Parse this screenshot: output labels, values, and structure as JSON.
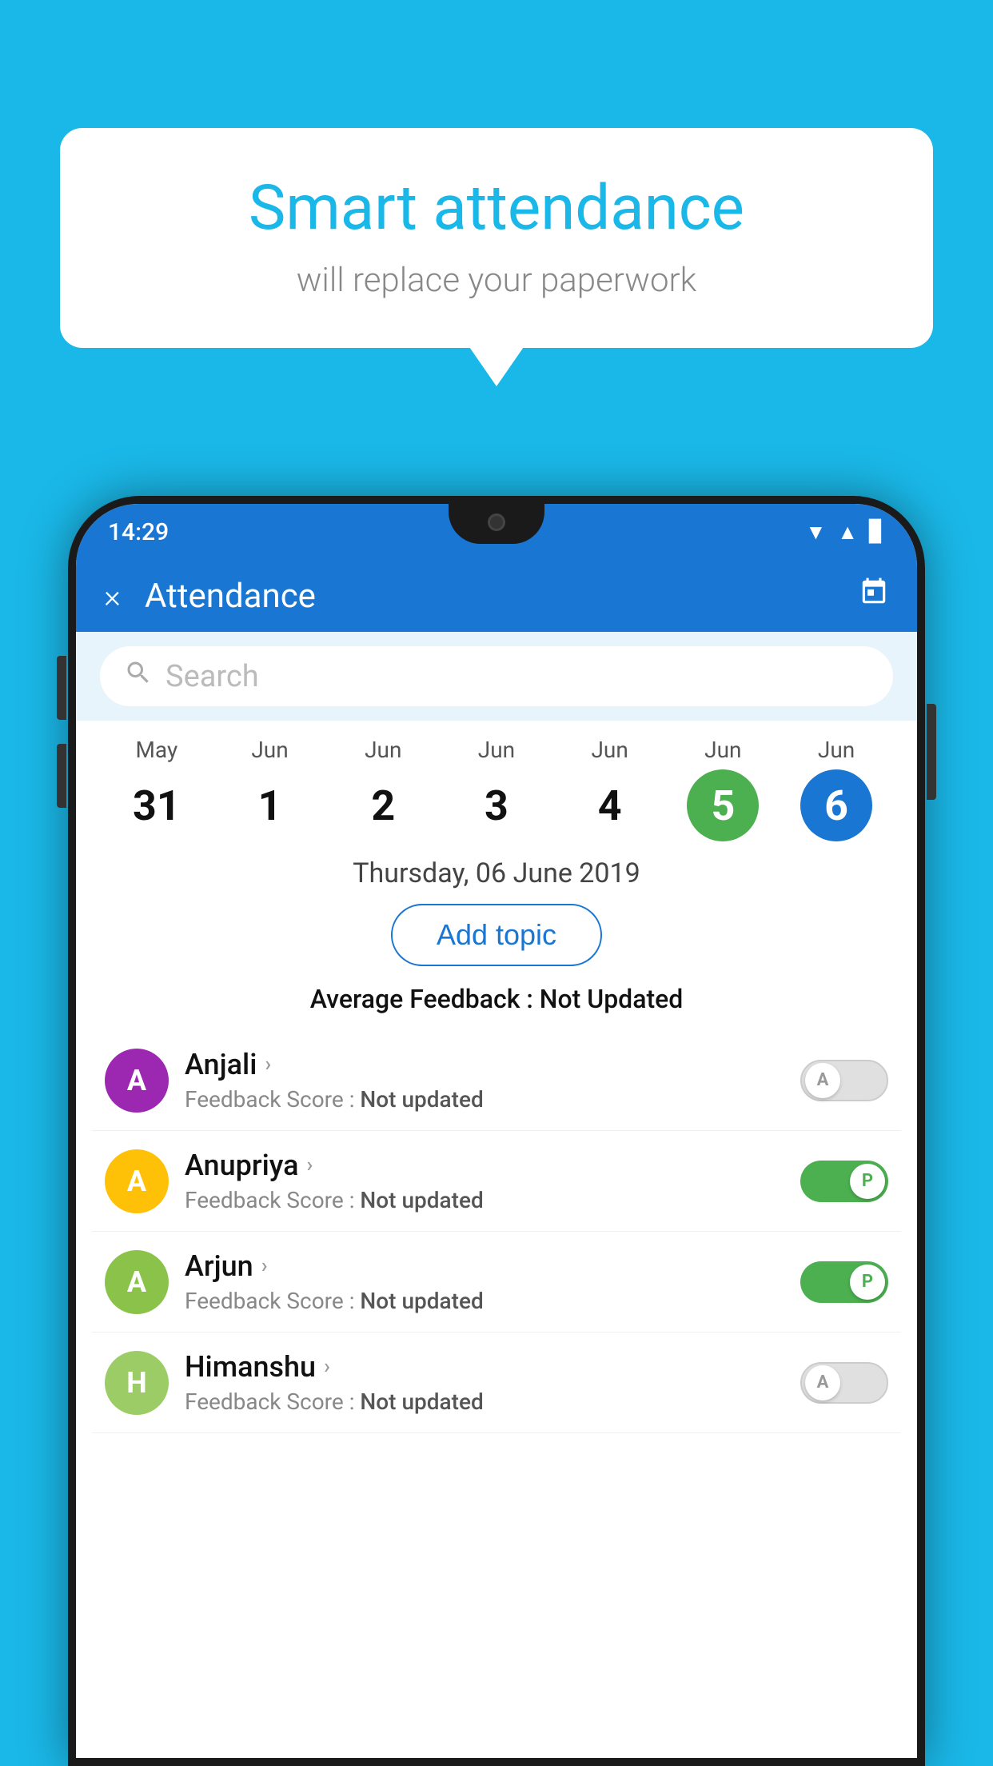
{
  "background_color": "#1ab8e8",
  "bubble": {
    "title": "Smart attendance",
    "subtitle": "will replace your paperwork"
  },
  "status_bar": {
    "time": "14:29",
    "icons": [
      "wifi",
      "signal",
      "battery"
    ]
  },
  "header": {
    "title": "Attendance",
    "close_label": "×",
    "calendar_icon": "📅"
  },
  "search": {
    "placeholder": "Search"
  },
  "calendar": {
    "days": [
      {
        "month": "May",
        "date": "31",
        "state": "normal"
      },
      {
        "month": "Jun",
        "date": "1",
        "state": "normal"
      },
      {
        "month": "Jun",
        "date": "2",
        "state": "normal"
      },
      {
        "month": "Jun",
        "date": "3",
        "state": "normal"
      },
      {
        "month": "Jun",
        "date": "4",
        "state": "normal"
      },
      {
        "month": "Jun",
        "date": "5",
        "state": "today"
      },
      {
        "month": "Jun",
        "date": "6",
        "state": "selected"
      }
    ]
  },
  "selected_date": "Thursday, 06 June 2019",
  "add_topic_label": "Add topic",
  "average_feedback": {
    "label": "Average Feedback : ",
    "value": "Not Updated"
  },
  "students": [
    {
      "name": "Anjali",
      "avatar_letter": "A",
      "avatar_color": "#9c27b0",
      "feedback_label": "Feedback Score : ",
      "feedback_value": "Not updated",
      "toggle_state": "off",
      "toggle_label": "A"
    },
    {
      "name": "Anupriya",
      "avatar_letter": "A",
      "avatar_color": "#ffc107",
      "feedback_label": "Feedback Score : ",
      "feedback_value": "Not updated",
      "toggle_state": "on",
      "toggle_label": "P"
    },
    {
      "name": "Arjun",
      "avatar_letter": "A",
      "avatar_color": "#8bc34a",
      "feedback_label": "Feedback Score : ",
      "feedback_value": "Not updated",
      "toggle_state": "on",
      "toggle_label": "P"
    },
    {
      "name": "Himanshu",
      "avatar_letter": "H",
      "avatar_color": "#9ccc65",
      "feedback_label": "Feedback Score : ",
      "feedback_value": "Not updated",
      "toggle_state": "off",
      "toggle_label": "A"
    }
  ]
}
